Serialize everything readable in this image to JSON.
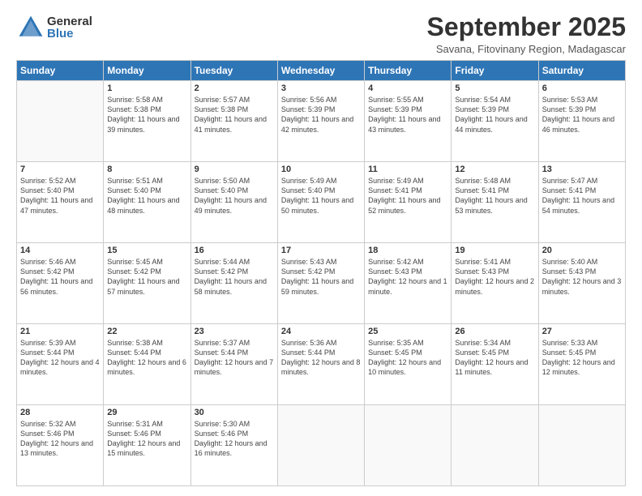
{
  "header": {
    "logo_general": "General",
    "logo_blue": "Blue",
    "month_title": "September 2025",
    "subtitle": "Savana, Fitovinany Region, Madagascar"
  },
  "weekdays": [
    "Sunday",
    "Monday",
    "Tuesday",
    "Wednesday",
    "Thursday",
    "Friday",
    "Saturday"
  ],
  "weeks": [
    [
      {
        "day": "",
        "sunrise": "",
        "sunset": "",
        "daylight": ""
      },
      {
        "day": "1",
        "sunrise": "Sunrise: 5:58 AM",
        "sunset": "Sunset: 5:38 PM",
        "daylight": "Daylight: 11 hours and 39 minutes."
      },
      {
        "day": "2",
        "sunrise": "Sunrise: 5:57 AM",
        "sunset": "Sunset: 5:38 PM",
        "daylight": "Daylight: 11 hours and 41 minutes."
      },
      {
        "day": "3",
        "sunrise": "Sunrise: 5:56 AM",
        "sunset": "Sunset: 5:39 PM",
        "daylight": "Daylight: 11 hours and 42 minutes."
      },
      {
        "day": "4",
        "sunrise": "Sunrise: 5:55 AM",
        "sunset": "Sunset: 5:39 PM",
        "daylight": "Daylight: 11 hours and 43 minutes."
      },
      {
        "day": "5",
        "sunrise": "Sunrise: 5:54 AM",
        "sunset": "Sunset: 5:39 PM",
        "daylight": "Daylight: 11 hours and 44 minutes."
      },
      {
        "day": "6",
        "sunrise": "Sunrise: 5:53 AM",
        "sunset": "Sunset: 5:39 PM",
        "daylight": "Daylight: 11 hours and 46 minutes."
      }
    ],
    [
      {
        "day": "7",
        "sunrise": "Sunrise: 5:52 AM",
        "sunset": "Sunset: 5:40 PM",
        "daylight": "Daylight: 11 hours and 47 minutes."
      },
      {
        "day": "8",
        "sunrise": "Sunrise: 5:51 AM",
        "sunset": "Sunset: 5:40 PM",
        "daylight": "Daylight: 11 hours and 48 minutes."
      },
      {
        "day": "9",
        "sunrise": "Sunrise: 5:50 AM",
        "sunset": "Sunset: 5:40 PM",
        "daylight": "Daylight: 11 hours and 49 minutes."
      },
      {
        "day": "10",
        "sunrise": "Sunrise: 5:49 AM",
        "sunset": "Sunset: 5:40 PM",
        "daylight": "Daylight: 11 hours and 50 minutes."
      },
      {
        "day": "11",
        "sunrise": "Sunrise: 5:49 AM",
        "sunset": "Sunset: 5:41 PM",
        "daylight": "Daylight: 11 hours and 52 minutes."
      },
      {
        "day": "12",
        "sunrise": "Sunrise: 5:48 AM",
        "sunset": "Sunset: 5:41 PM",
        "daylight": "Daylight: 11 hours and 53 minutes."
      },
      {
        "day": "13",
        "sunrise": "Sunrise: 5:47 AM",
        "sunset": "Sunset: 5:41 PM",
        "daylight": "Daylight: 11 hours and 54 minutes."
      }
    ],
    [
      {
        "day": "14",
        "sunrise": "Sunrise: 5:46 AM",
        "sunset": "Sunset: 5:42 PM",
        "daylight": "Daylight: 11 hours and 56 minutes."
      },
      {
        "day": "15",
        "sunrise": "Sunrise: 5:45 AM",
        "sunset": "Sunset: 5:42 PM",
        "daylight": "Daylight: 11 hours and 57 minutes."
      },
      {
        "day": "16",
        "sunrise": "Sunrise: 5:44 AM",
        "sunset": "Sunset: 5:42 PM",
        "daylight": "Daylight: 11 hours and 58 minutes."
      },
      {
        "day": "17",
        "sunrise": "Sunrise: 5:43 AM",
        "sunset": "Sunset: 5:42 PM",
        "daylight": "Daylight: 11 hours and 59 minutes."
      },
      {
        "day": "18",
        "sunrise": "Sunrise: 5:42 AM",
        "sunset": "Sunset: 5:43 PM",
        "daylight": "Daylight: 12 hours and 1 minute."
      },
      {
        "day": "19",
        "sunrise": "Sunrise: 5:41 AM",
        "sunset": "Sunset: 5:43 PM",
        "daylight": "Daylight: 12 hours and 2 minutes."
      },
      {
        "day": "20",
        "sunrise": "Sunrise: 5:40 AM",
        "sunset": "Sunset: 5:43 PM",
        "daylight": "Daylight: 12 hours and 3 minutes."
      }
    ],
    [
      {
        "day": "21",
        "sunrise": "Sunrise: 5:39 AM",
        "sunset": "Sunset: 5:44 PM",
        "daylight": "Daylight: 12 hours and 4 minutes."
      },
      {
        "day": "22",
        "sunrise": "Sunrise: 5:38 AM",
        "sunset": "Sunset: 5:44 PM",
        "daylight": "Daylight: 12 hours and 6 minutes."
      },
      {
        "day": "23",
        "sunrise": "Sunrise: 5:37 AM",
        "sunset": "Sunset: 5:44 PM",
        "daylight": "Daylight: 12 hours and 7 minutes."
      },
      {
        "day": "24",
        "sunrise": "Sunrise: 5:36 AM",
        "sunset": "Sunset: 5:44 PM",
        "daylight": "Daylight: 12 hours and 8 minutes."
      },
      {
        "day": "25",
        "sunrise": "Sunrise: 5:35 AM",
        "sunset": "Sunset: 5:45 PM",
        "daylight": "Daylight: 12 hours and 10 minutes."
      },
      {
        "day": "26",
        "sunrise": "Sunrise: 5:34 AM",
        "sunset": "Sunset: 5:45 PM",
        "daylight": "Daylight: 12 hours and 11 minutes."
      },
      {
        "day": "27",
        "sunrise": "Sunrise: 5:33 AM",
        "sunset": "Sunset: 5:45 PM",
        "daylight": "Daylight: 12 hours and 12 minutes."
      }
    ],
    [
      {
        "day": "28",
        "sunrise": "Sunrise: 5:32 AM",
        "sunset": "Sunset: 5:46 PM",
        "daylight": "Daylight: 12 hours and 13 minutes."
      },
      {
        "day": "29",
        "sunrise": "Sunrise: 5:31 AM",
        "sunset": "Sunset: 5:46 PM",
        "daylight": "Daylight: 12 hours and 15 minutes."
      },
      {
        "day": "30",
        "sunrise": "Sunrise: 5:30 AM",
        "sunset": "Sunset: 5:46 PM",
        "daylight": "Daylight: 12 hours and 16 minutes."
      },
      {
        "day": "",
        "sunrise": "",
        "sunset": "",
        "daylight": ""
      },
      {
        "day": "",
        "sunrise": "",
        "sunset": "",
        "daylight": ""
      },
      {
        "day": "",
        "sunrise": "",
        "sunset": "",
        "daylight": ""
      },
      {
        "day": "",
        "sunrise": "",
        "sunset": "",
        "daylight": ""
      }
    ]
  ]
}
